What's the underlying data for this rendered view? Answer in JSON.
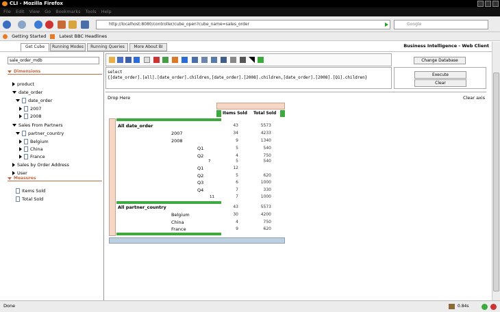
{
  "window": {
    "title": "CLI - Mozilla Firefox"
  },
  "menubar": {
    "items": [
      "File",
      "Edit",
      "View",
      "Go",
      "Bookmarks",
      "Tools",
      "Help"
    ]
  },
  "nav": {
    "url": "http://localhost:8080/controller/cube_open?cube_name=sales_order",
    "search_placeholder": "Google"
  },
  "bookmarks": {
    "items": [
      "Getting Started",
      "Latest BBC Headlines"
    ]
  },
  "tabs": {
    "items": [
      "Get Cube",
      "Running Modes",
      "Running Queries",
      "More About BI"
    ]
  },
  "app": {
    "title": "Business Intelligence - Web Client"
  },
  "left": {
    "cube_name": "sale_order_mdb",
    "dimensions_label": "Dimensions",
    "measures_label": "Measures",
    "tree": {
      "product": "product",
      "date_order": "date_order",
      "date_order_child": "date_order",
      "y2007": "2007",
      "y2008": "2008",
      "sales_from_partners": "Sales From Partners",
      "partner_country": "partner_country",
      "belgium": "Belgium",
      "china": "China",
      "france": "France",
      "sales_by_order_address": "Sales by Order Address",
      "user": "User"
    },
    "measures": [
      "Items Sold",
      "Total Sold"
    ]
  },
  "query": {
    "text": "select\n{[date_order].[all].[date_order].children,[date_order].[2008].children,[date_order].[2008].[Q1].children}"
  },
  "buttons": {
    "change_db": "Change Database",
    "execute": "Execute",
    "clear": "Clear"
  },
  "grid": {
    "drop_here": "Drop Here",
    "clear_axis": "Clear axis",
    "columns": [
      "Items Sold",
      "Total Sold"
    ],
    "rows": [
      {
        "label": "All date_order",
        "items": "43",
        "total": "5573"
      },
      {
        "label": "2007",
        "items": "34",
        "total": "4233"
      },
      {
        "label": "2008",
        "items": "9",
        "total": "1340"
      },
      {
        "label": "Q1",
        "items": "5",
        "total": "540"
      },
      {
        "label": "Q2",
        "items": "4",
        "total": "750"
      },
      {
        "label": "7",
        "items": "5",
        "total": "540"
      },
      {
        "label": "Q1",
        "items": "12",
        "total": ""
      },
      {
        "label": "Q2",
        "items": "5",
        "total": "620"
      },
      {
        "label": "Q3",
        "items": "6",
        "total": "1000"
      },
      {
        "label": "Q4",
        "items": "7",
        "total": "330"
      },
      {
        "label": "11",
        "items": "7",
        "total": "1000"
      },
      {
        "label": "All partner_country",
        "items": "43",
        "total": "5573"
      },
      {
        "label": "Belgium",
        "items": "30",
        "total": "4200"
      },
      {
        "label": "China",
        "items": "4",
        "total": "750"
      },
      {
        "label": "France",
        "items": "9",
        "total": "620"
      }
    ]
  },
  "status": {
    "text": "Done",
    "right": "0.84s"
  },
  "colors": {
    "accent_orange": "#c06a40",
    "peach": "#f6d7c5",
    "green": "#3caa3c",
    "blue_bar": "#bcd0e0"
  }
}
